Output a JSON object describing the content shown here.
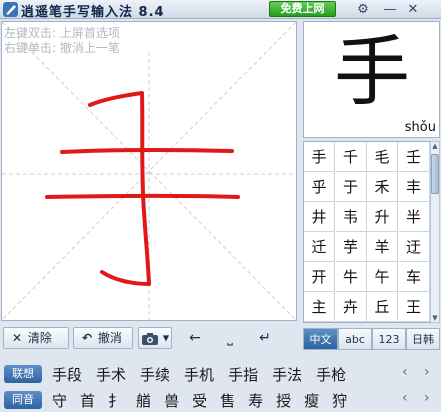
{
  "titlebar": {
    "title": "逍遥笔手写输入法 8.4",
    "free_net": "免费上网",
    "settings_glyph": "⚙",
    "minimize_glyph": "—",
    "close_glyph": "✕"
  },
  "pad": {
    "hint_left": "左键双击: 上屏首选项",
    "hint_right": "右键单击: 撤消上一笔",
    "stroke_color": "#e01818"
  },
  "preview": {
    "char": "手",
    "pinyin": "shǒu"
  },
  "candidates_grid": [
    [
      "手",
      "千",
      "毛",
      "壬"
    ],
    [
      "乎",
      "于",
      "禾",
      "丰"
    ],
    [
      "井",
      "韦",
      "升",
      "半"
    ],
    [
      "迁",
      "芋",
      "羊",
      "迂"
    ],
    [
      "开",
      "牛",
      "午",
      "车"
    ],
    [
      "主",
      "卉",
      "丘",
      "王"
    ]
  ],
  "modes": [
    "中文",
    "abc",
    "123",
    "日韩"
  ],
  "toolbar": {
    "clear": "清除",
    "undo": "撤消"
  },
  "assoc": {
    "label": "联想",
    "words": [
      "手段",
      "手术",
      "手续",
      "手机",
      "手指",
      "手法",
      "手枪"
    ]
  },
  "homophone": {
    "label": "同音",
    "chars": [
      "守",
      "首",
      "扌",
      "艏",
      "兽",
      "受",
      "售",
      "寿",
      "授",
      "瘦",
      "狩"
    ]
  },
  "colors": {
    "accent": "#2e63a0",
    "ink": "#e01818",
    "free_net_green": "#2a9b22"
  }
}
